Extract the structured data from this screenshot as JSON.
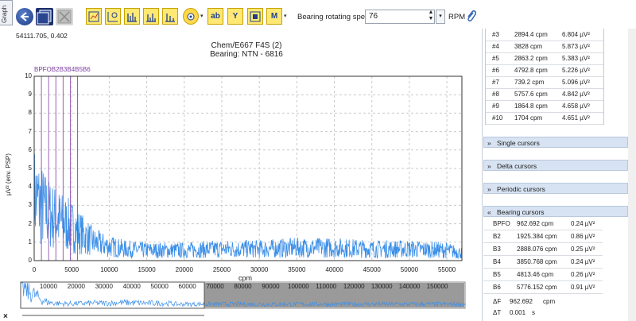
{
  "tab": {
    "label": "Graph"
  },
  "toolbar": {
    "buttons": [
      "back-icon",
      "window-icon",
      "disabled-icon"
    ],
    "icon_buttons": [
      {
        "name": "trend-report-icon"
      },
      {
        "name": "time-waveform-icon"
      },
      {
        "name": "spectrum-m-icon"
      },
      {
        "name": "peaks-icon"
      },
      {
        "name": "harmonics-icon"
      },
      {
        "name": "gear-icon"
      },
      {
        "name": "label-icon",
        "text": "ab"
      },
      {
        "name": "y-axis-icon",
        "text": "Y"
      },
      {
        "name": "export-icon"
      },
      {
        "name": "marker-icon",
        "text": "M"
      }
    ],
    "speed_label": "Bearing rotating speed",
    "speed_value": "76",
    "rpm_label": "RPM"
  },
  "chart": {
    "coordinates": "54111.705, 0.402",
    "title_line1": "Chem/E667 F4S (2)",
    "title_line2": "Bearing:  NTN - 6816",
    "bearing_markers_label": "BPFOB2B3B4B5B6",
    "ylabel": "µV² (env. PSP)",
    "xlabel": "cpm",
    "overview_ticks": [
      "10000",
      "20000",
      "30000",
      "40000",
      "50000",
      "60000",
      "70000",
      "80000",
      "90000",
      "100000",
      "110000",
      "120000",
      "130000",
      "140000",
      "150000"
    ]
  },
  "chart_data": {
    "type": "line",
    "title": "Chem/E667 F4S (2)",
    "subtitle": "Bearing:  NTN - 6816",
    "xlabel": "cpm",
    "ylabel": "µV² (env. PSP)",
    "xlim": [
      0,
      57000
    ],
    "ylim": [
      0,
      10
    ],
    "yticks": [
      "0",
      "1",
      "2",
      "3",
      "4",
      "5",
      "6",
      "7",
      "8",
      "9",
      "10"
    ],
    "xticks": [
      "0",
      "5000",
      "10000",
      "15000",
      "20000",
      "25000",
      "30000",
      "35000",
      "40000",
      "45000",
      "50000",
      "55000"
    ],
    "grid": true,
    "series": [
      {
        "color": "#3b8fe8",
        "x": [
          0,
          1000,
          2000,
          3000,
          4000,
          5000,
          6000,
          8000,
          10000,
          12000,
          15000,
          20000,
          25000,
          30000,
          35000,
          40000,
          45000,
          50000,
          55000,
          57000
        ],
        "y": [
          5.0,
          4.2,
          3.6,
          3.2,
          2.9,
          2.6,
          2.2,
          1.4,
          1.1,
          0.9,
          0.8,
          0.8,
          0.9,
          0.9,
          1.0,
          1.0,
          0.9,
          0.9,
          0.8,
          0.6
        ]
      }
    ],
    "bearing_lines_cpm": [
      962.692,
      1925.384,
      2888.076,
      3850.768,
      4813.46,
      5776.152
    ]
  },
  "peaks_table": {
    "rows": [
      {
        "id": "#3",
        "freq": "2894.4 cpm",
        "amp": "6.804 µV²"
      },
      {
        "id": "#4",
        "freq": "3828 cpm",
        "amp": "5.873 µV²"
      },
      {
        "id": "#5",
        "freq": "2863.2 cpm",
        "amp": "5.383 µV²"
      },
      {
        "id": "#6",
        "freq": "4792.8 cpm",
        "amp": "5.226 µV²"
      },
      {
        "id": "#7",
        "freq": "739.2 cpm",
        "amp": "5.096 µV²"
      },
      {
        "id": "#8",
        "freq": "5757.6 cpm",
        "amp": "4.842 µV²"
      },
      {
        "id": "#9",
        "freq": "1864.8 cpm",
        "amp": "4.658 µV²"
      },
      {
        "id": "#10",
        "freq": "1704 cpm",
        "amp": "4.651 µV²"
      }
    ]
  },
  "sections": {
    "single": "Single cursors",
    "delta": "Delta cursors",
    "periodic": "Periodic cursors",
    "bearing": "Bearing cursors"
  },
  "bearing_cursors": {
    "rows": [
      {
        "name": "BPFO",
        "freq": "962.692 cpm",
        "amp": "0.24 µV²"
      },
      {
        "name": "B2",
        "freq": "1925.384 cpm",
        "amp": "0.86 µV²"
      },
      {
        "name": "B3",
        "freq": "2888.076 cpm",
        "amp": "0.25 µV²"
      },
      {
        "name": "B4",
        "freq": "3850.768 cpm",
        "amp": "0.24 µV²"
      },
      {
        "name": "B5",
        "freq": "4813.46 cpm",
        "amp": "0.26 µV²"
      },
      {
        "name": "B6",
        "freq": "5776.152 cpm",
        "amp": "0.91 µV²"
      }
    ],
    "delta_f_label": "ΔF",
    "delta_f_value": "962.692",
    "delta_f_unit": "cpm",
    "delta_t_label": "ΔT",
    "delta_t_value": "0.001",
    "delta_t_unit": "s"
  },
  "close_label": "×"
}
